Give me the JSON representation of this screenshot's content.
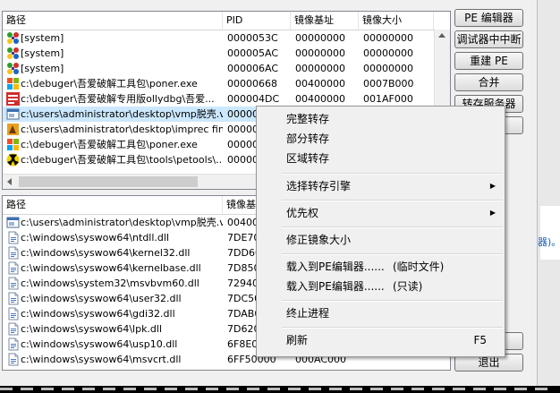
{
  "process_list": {
    "columns": [
      "路径",
      "PID",
      "镜像基址",
      "镜像大小"
    ],
    "rows": [
      {
        "icon": "system-process-icon",
        "path": "[system]",
        "pid": "0000053C",
        "base": "00000000",
        "size": "00000000"
      },
      {
        "icon": "system-process-icon",
        "path": "[system]",
        "pid": "000005AC",
        "base": "00000000",
        "size": "00000000"
      },
      {
        "icon": "system-process-icon",
        "path": "[system]",
        "pid": "000006AC",
        "base": "00000000",
        "size": "00000000"
      },
      {
        "icon": "app-window-icon",
        "path": "c:\\debuger\\吾爱破解工具包\\poner.exe",
        "pid": "00000668",
        "base": "00400000",
        "size": "0007B000"
      },
      {
        "icon": "ollydbg-icon",
        "path": "c:\\debuger\\吾爱破解专用版ollydbg\\吾爱...",
        "pid": "000004DC",
        "base": "00400000",
        "size": "001AF000"
      },
      {
        "icon": "vmp-exe-icon",
        "path": "c:\\users\\administrator\\desktop\\vmp脱壳.vm...",
        "pid": "00000",
        "base": "",
        "size": "",
        "selected": true
      },
      {
        "icon": "imprec-icon",
        "path": "c:\\users\\administrator\\desktop\\imprec final 1...",
        "pid": "00000",
        "base": "",
        "size": ""
      },
      {
        "icon": "app-window-icon",
        "path": "c:\\debuger\\吾爱破解工具包\\poner.exe",
        "pid": "00000",
        "base": "",
        "size": ""
      },
      {
        "icon": "petools-icon",
        "path": "c:\\debuger\\吾爱破解工具包\\tools\\petools\\...",
        "pid": "00000",
        "base": "",
        "size": ""
      }
    ]
  },
  "module_list": {
    "columns": [
      "路径",
      "镜像基"
    ],
    "rows": [
      {
        "icon": "vmp-exe-icon",
        "path": "c:\\users\\administrator\\desktop\\vmp脱壳.vm...",
        "base": "00400",
        "size": ""
      },
      {
        "icon": "dll-file-icon",
        "path": "c:\\windows\\syswow64\\ntdll.dll",
        "base": "7DE70",
        "size": ""
      },
      {
        "icon": "dll-file-icon",
        "path": "c:\\windows\\syswow64\\kernel32.dll",
        "base": "7DD60",
        "size": ""
      },
      {
        "icon": "dll-file-icon",
        "path": "c:\\windows\\syswow64\\kernelbase.dll",
        "base": "7D850",
        "size": ""
      },
      {
        "icon": "dll-file-icon",
        "path": "c:\\windows\\system32\\msvbvm60.dll",
        "base": "72940",
        "size": ""
      },
      {
        "icon": "dll-file-icon",
        "path": "c:\\windows\\syswow64\\user32.dll",
        "base": "7DC50",
        "size": ""
      },
      {
        "icon": "dll-file-icon",
        "path": "c:\\windows\\syswow64\\gdi32.dll",
        "base": "7DAB0",
        "size": ""
      },
      {
        "icon": "dll-file-icon",
        "path": "c:\\windows\\syswow64\\lpk.dll",
        "base": "7D620",
        "size": ""
      },
      {
        "icon": "dll-file-icon",
        "path": "c:\\windows\\syswow64\\usp10.dll",
        "base": "6F8E0",
        "size": ""
      },
      {
        "icon": "dll-file-icon",
        "path": "c:\\windows\\syswow64\\msvcrt.dll",
        "base": "6FF50000",
        "size": "000AC000"
      }
    ]
  },
  "buttons": {
    "pe_editor": "PE 编辑器",
    "debugger_break": "调试器中中断",
    "rebuild_pe": "重建 PE",
    "merge": "合并",
    "dump_server": "转存服务器",
    "exit": "退出"
  },
  "context_menu": {
    "full_dump": "完整转存",
    "partial_dump": "部分转存",
    "region_dump": "区域转存",
    "select_dump_engine": "选择转存引擎",
    "priority": "优先权",
    "fix_image_size": "修正镜象大小",
    "load_pe_editor_temp": "载入到PE编辑器......",
    "temp_file_note": "(临时文件)",
    "load_pe_editor_readonly": "载入到PE编辑器......",
    "readonly_note": "(只读)",
    "terminate_process": "终止进程",
    "refresh": "刷新",
    "refresh_shortcut": "F5"
  },
  "background_fragment": "器)。"
}
